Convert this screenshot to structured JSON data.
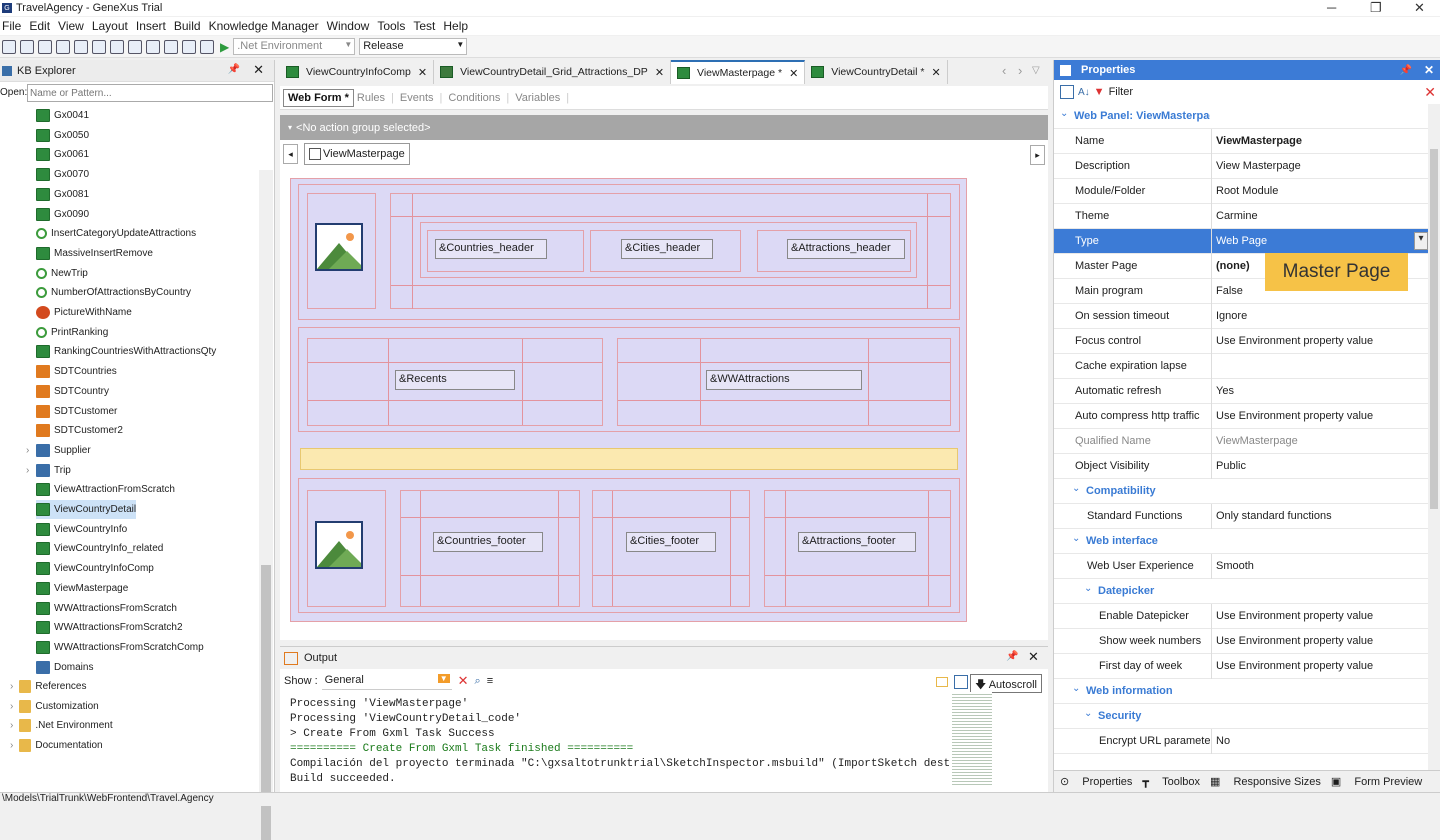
{
  "window": {
    "title": "TravelAgency - GeneXus Trial"
  },
  "menu": [
    "File",
    "Edit",
    "View",
    "Layout",
    "Insert",
    "Build",
    "Knowledge Manager",
    "Window",
    "Tools",
    "Test",
    "Help"
  ],
  "toolbar": {
    "environment": ".Net Environment",
    "config": "Release"
  },
  "kb": {
    "title": "KB Explorer",
    "open_label": "Open:",
    "placeholder": "Name or Pattern...",
    "items": [
      {
        "label": "Gx0041",
        "icon": "webpanel-icon"
      },
      {
        "label": "Gx0050",
        "icon": "webpanel-icon"
      },
      {
        "label": "Gx0061",
        "icon": "webpanel-icon"
      },
      {
        "label": "Gx0070",
        "icon": "webpanel-icon"
      },
      {
        "label": "Gx0081",
        "icon": "webpanel-icon"
      },
      {
        "label": "Gx0090",
        "icon": "webpanel-icon"
      },
      {
        "label": "InsertCategoryUpdateAttractions",
        "icon": "procedure-icon"
      },
      {
        "label": "MassiveInsertRemove",
        "icon": "webpanel-icon"
      },
      {
        "label": "NewTrip",
        "icon": "procedure-icon"
      },
      {
        "label": "NumberOfAttractionsByCountry",
        "icon": "procedure-icon"
      },
      {
        "label": "PictureWithName",
        "icon": "picture-icon"
      },
      {
        "label": "PrintRanking",
        "icon": "procedure-icon"
      },
      {
        "label": "RankingCountriesWithAttractionsQty",
        "icon": "webpanel-icon"
      },
      {
        "label": "SDTCountries",
        "icon": "sdt-icon"
      },
      {
        "label": "SDTCountry",
        "icon": "sdt-icon"
      },
      {
        "label": "SDTCustomer",
        "icon": "sdt-icon"
      },
      {
        "label": "SDTCustomer2",
        "icon": "sdt-icon"
      },
      {
        "label": "Supplier",
        "icon": "transaction-icon"
      },
      {
        "label": "Trip",
        "icon": "transaction-icon"
      },
      {
        "label": "ViewAttractionFromScratch",
        "icon": "webpanel-icon"
      },
      {
        "label": "ViewCountryDetail",
        "icon": "webpanel-icon"
      },
      {
        "label": "ViewCountryInfo",
        "icon": "webpanel-icon"
      },
      {
        "label": "ViewCountryInfo_related",
        "icon": "webpanel-icon"
      },
      {
        "label": "ViewCountryInfoComp",
        "icon": "webpanel-icon"
      },
      {
        "label": "ViewMasterpage",
        "icon": "webpanel-icon"
      },
      {
        "label": "WWAttractionsFromScratch",
        "icon": "webpanel-icon"
      },
      {
        "label": "WWAttractionsFromScratch2",
        "icon": "webpanel-icon"
      },
      {
        "label": "WWAttractionsFromScratchComp",
        "icon": "webpanel-icon"
      },
      {
        "label": "Domains",
        "icon": "domains-icon"
      }
    ],
    "root_items": [
      "References",
      "Customization",
      ".Net Environment",
      "Documentation"
    ]
  },
  "tabs": [
    {
      "label": "ViewCountryInfoComp"
    },
    {
      "label": "ViewCountryDetail_Grid_Attractions_DP"
    },
    {
      "label": "ViewMasterpage *"
    },
    {
      "label": "ViewCountryDetail *"
    }
  ],
  "subtabs": [
    "Web Form *",
    "Rules",
    "Events",
    "Conditions",
    "Variables"
  ],
  "action_group": "<No action group selected>",
  "breadcrumb": "ViewMasterpage",
  "form": {
    "countries_header": "&Countries_header",
    "cities_header": "&Cities_header",
    "attractions_header": "&Attractions_header",
    "recents": "&Recents",
    "wwattractions": "&WWAttractions",
    "countries_footer": "&Countries_footer",
    "cities_footer": "&Cities_footer",
    "attractions_footer": "&Attractions_footer"
  },
  "output": {
    "title": "Output",
    "show_label": "Show :",
    "show_value": "General",
    "autoscroll": "Autoscroll",
    "lines": [
      "Processing 'ViewMasterpage'",
      "Processing 'ViewCountryDetail_code'",
      "> Create From Gxml Task Success",
      "========== Create From Gxml Task finished ==========",
      "Compilación del proyecto terminada \"C:\\gxsaltotrunktrial\\SketchInspector.msbuild\" (ImportSketch destinos).",
      "Build succeeded."
    ]
  },
  "properties": {
    "title": "Properties",
    "filter": "Filter",
    "rows": [
      {
        "name": "Web Panel: ViewMasterpage",
        "value": "",
        "kind": "cat",
        "indent": 0
      },
      {
        "name": "Name",
        "value": "ViewMasterpage",
        "kind": "bold",
        "indent": 1
      },
      {
        "name": "Description",
        "value": "View Masterpage",
        "kind": "",
        "indent": 1
      },
      {
        "name": "Module/Folder",
        "value": "Root Module",
        "kind": "",
        "indent": 1
      },
      {
        "name": "Theme",
        "value": "Carmine",
        "kind": "",
        "indent": 1
      },
      {
        "name": "Type",
        "value": "Web Page",
        "kind": "sel",
        "indent": 1
      },
      {
        "name": "Master Page",
        "value": "(none)",
        "kind": "bold",
        "indent": 1
      },
      {
        "name": "Main program",
        "value": "False",
        "kind": "",
        "indent": 1
      },
      {
        "name": "On session timeout",
        "value": "Ignore",
        "kind": "",
        "indent": 1
      },
      {
        "name": "Focus control",
        "value": "Use Environment property value",
        "kind": "",
        "indent": 1
      },
      {
        "name": "Cache expiration lapse",
        "value": "",
        "kind": "",
        "indent": 1
      },
      {
        "name": "Automatic refresh",
        "value": "Yes",
        "kind": "",
        "indent": 1
      },
      {
        "name": "Auto compress http traffic",
        "value": "Use Environment property value",
        "kind": "",
        "indent": 1
      },
      {
        "name": "Qualified Name",
        "value": "ViewMasterpage",
        "kind": "grey",
        "indent": 1
      },
      {
        "name": "Object Visibility",
        "value": "Public",
        "kind": "",
        "indent": 1
      },
      {
        "name": "Compatibility",
        "value": "",
        "kind": "cat",
        "indent": 1
      },
      {
        "name": "Standard Functions",
        "value": "Only standard functions",
        "kind": "",
        "indent": 2
      },
      {
        "name": "Web interface",
        "value": "",
        "kind": "cat",
        "indent": 1
      },
      {
        "name": "Web User Experience",
        "value": "Smooth",
        "kind": "",
        "indent": 2
      },
      {
        "name": "Datepicker",
        "value": "",
        "kind": "cat",
        "indent": 2
      },
      {
        "name": "Enable Datepicker",
        "value": "Use Environment property value",
        "kind": "",
        "indent": 3
      },
      {
        "name": "Show week numbers",
        "value": "Use Environment property value",
        "kind": "",
        "indent": 3
      },
      {
        "name": "First day of week",
        "value": "Use Environment property value",
        "kind": "",
        "indent": 3
      },
      {
        "name": "Web information",
        "value": "",
        "kind": "cat",
        "indent": 1
      },
      {
        "name": "Security",
        "value": "",
        "kind": "cat",
        "indent": 2
      },
      {
        "name": "Encrypt URL paramete",
        "value": "No",
        "kind": "",
        "indent": 3
      }
    ],
    "tooltip": "Master Page",
    "bottom_tabs": [
      "Properties",
      "Toolbox",
      "Responsive Sizes",
      "Form Preview"
    ]
  },
  "status": "\\Models\\TrialTrunk\\WebFrontend\\Travel.Agency"
}
